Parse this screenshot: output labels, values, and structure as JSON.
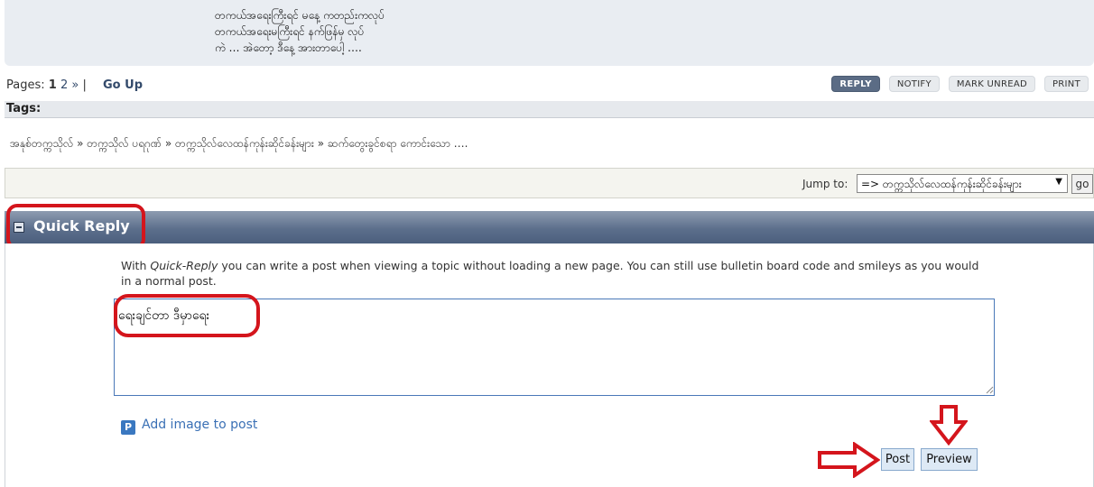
{
  "post": {
    "lines": [
      "တကယ်အရေးကြီးရင် မနေ့ ကတည်းကလုပ်",
      "တကယ်အရေးမကြီးရင် နက်ဖြန်မှ လုပ်",
      "ကဲ … အဲတော့ ဒီနေ့ အားတာပေါ့ …."
    ]
  },
  "pagination": {
    "label": "Pages:",
    "current": "1",
    "next_page": "2",
    "next_arrow": "»",
    "separator": "|",
    "go_up": "Go Up"
  },
  "action_buttons": {
    "reply": "REPLY",
    "notify": "NOTIFY",
    "mark_unread": "MARK UNREAD",
    "print": "PRINT"
  },
  "tags": {
    "label": "Tags:"
  },
  "breadcrumb": {
    "items": [
      "အနုစ်တက္ကသိုလ်",
      "တက္ကသိုလ် ပရဂုဏ်",
      "တက္ကသိုလ်လေထန်ကုန်းဆိုင်ခန်းများ",
      "ဆက်တွေးခွင်စရာ ကောင်းသော …."
    ],
    "separator": "»"
  },
  "jump": {
    "label": "Jump to:",
    "selected": "=> တက္ကသိုလ်လေထန်ကုန်းဆိုင်ခန်းများ",
    "go": "go"
  },
  "quick_reply": {
    "title": "Quick Reply",
    "desc_before": "With ",
    "desc_em": "Quick-Reply",
    "desc_after": " you can write a post when viewing a topic without loading a new page. You can still use bulletin board code and smileys as you would in a normal post.",
    "textarea_value": "ရေးချင်တာ ဒီမှာရေး",
    "add_image": "Add image to post",
    "add_image_icon": "P",
    "post_button": "Post",
    "preview_button": "Preview"
  },
  "colors": {
    "highlight": "#d4151c",
    "header_bar": "#5c6f8c",
    "link": "#3a70b5"
  }
}
